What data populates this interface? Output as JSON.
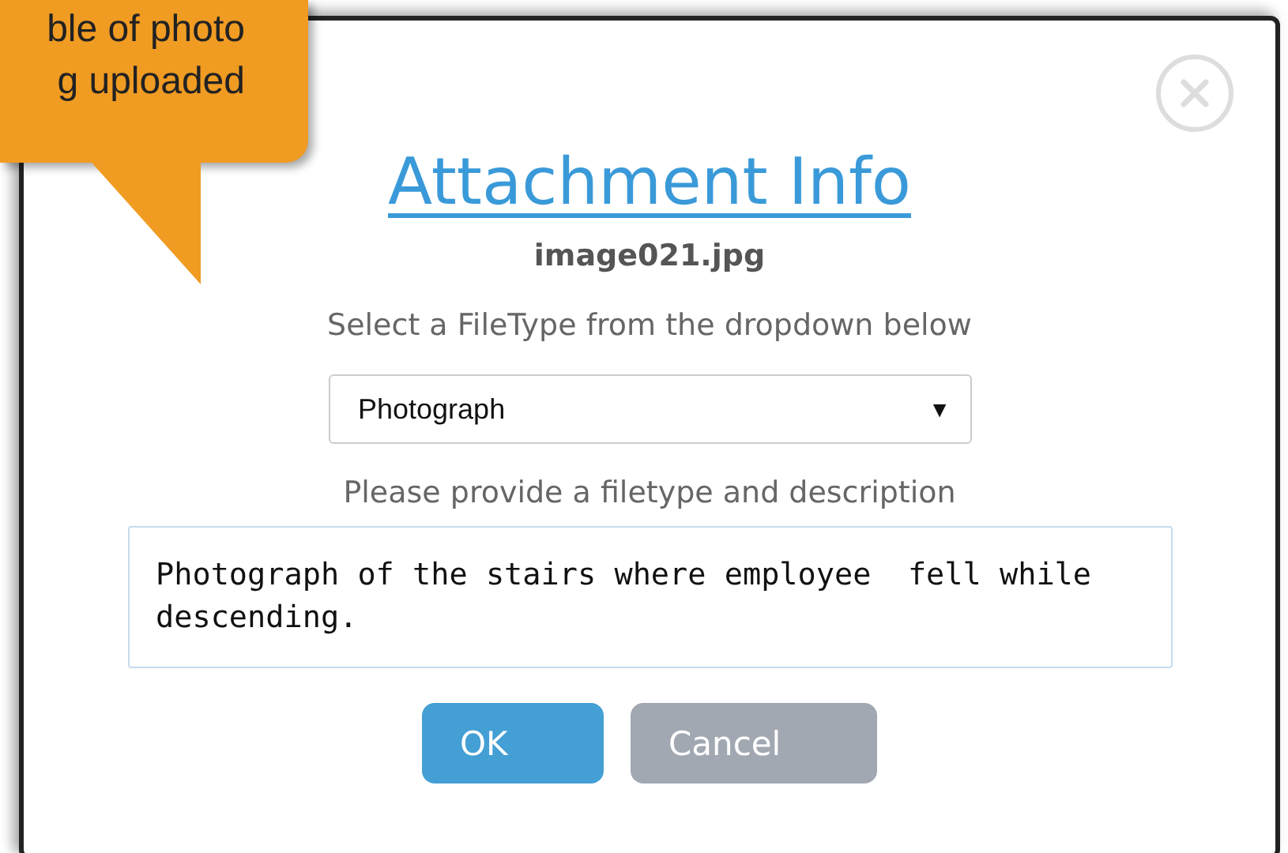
{
  "callout": {
    "lines": [
      "ble of photo",
      "g uploaded"
    ]
  },
  "dialog": {
    "title": "Attachment Info",
    "filename": "image021.jpg",
    "instruction": "Select a FileType from the dropdown below",
    "filetype": {
      "value": "Photograph",
      "arrow": "▼"
    },
    "prompt": "Please provide a filetype and description",
    "description": {
      "value": "Photograph of the stairs where employee  fell while descending."
    },
    "buttons": [
      {
        "label": "OK",
        "kind": "primary"
      },
      {
        "label": "Cancel",
        "kind": "secondary"
      }
    ]
  }
}
